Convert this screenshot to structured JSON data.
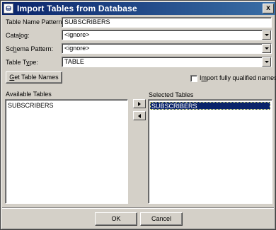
{
  "window": {
    "title": "Import Tables from Database",
    "close_label": "x",
    "icon_glyph": "⛁"
  },
  "form": {
    "table_name_pattern": {
      "label": "Table Name Pattern:",
      "value": "SUBSCRIBERS"
    },
    "catalog": {
      "label_pre": "Cata",
      "label_u": "l",
      "label_post": "og:",
      "value": "<ignore>"
    },
    "schema_pattern": {
      "label_pre": "Sc",
      "label_u": "h",
      "label_post": "ema Pattern:",
      "value": "<ignore>"
    },
    "table_type": {
      "label_pre": "Table T",
      "label_u": "y",
      "label_post": "pe:",
      "value": "TABLE"
    }
  },
  "get_table_names": {
    "label_u": "G",
    "label_rest": "et Table Names"
  },
  "import_qualified": {
    "label_pre": "I",
    "label_u": "m",
    "label_post": "port fully qualified names",
    "checked": false
  },
  "available": {
    "header": "Available Tables",
    "items": [
      "SUBSCRIBERS"
    ]
  },
  "selected": {
    "header": "Selected Tables",
    "items": [
      "SUBSCRIBERS"
    ]
  },
  "buttons": {
    "ok": "OK",
    "cancel": "Cancel"
  }
}
